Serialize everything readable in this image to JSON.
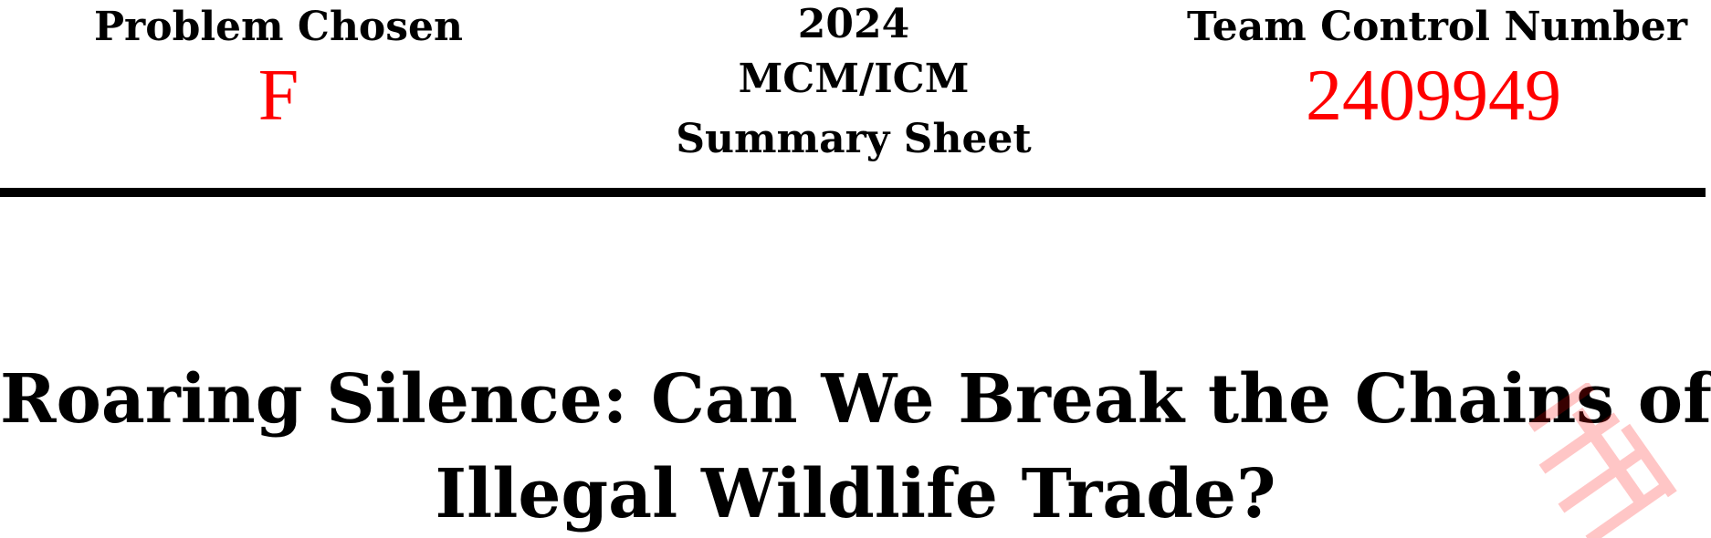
{
  "header": {
    "problem_label": "Problem Chosen",
    "problem_value": "F",
    "year": "2024",
    "contest": "MCM/ICM",
    "sheet": "Summary Sheet",
    "team_label": "Team Control Number",
    "team_value": "2409949"
  },
  "title": {
    "line1": "Roaring Silence: Can We Break the Chains of",
    "line2": "Illegal Wildlife Trade?"
  },
  "colors": {
    "accent_red": "#ff0000",
    "rule": "#000000"
  }
}
